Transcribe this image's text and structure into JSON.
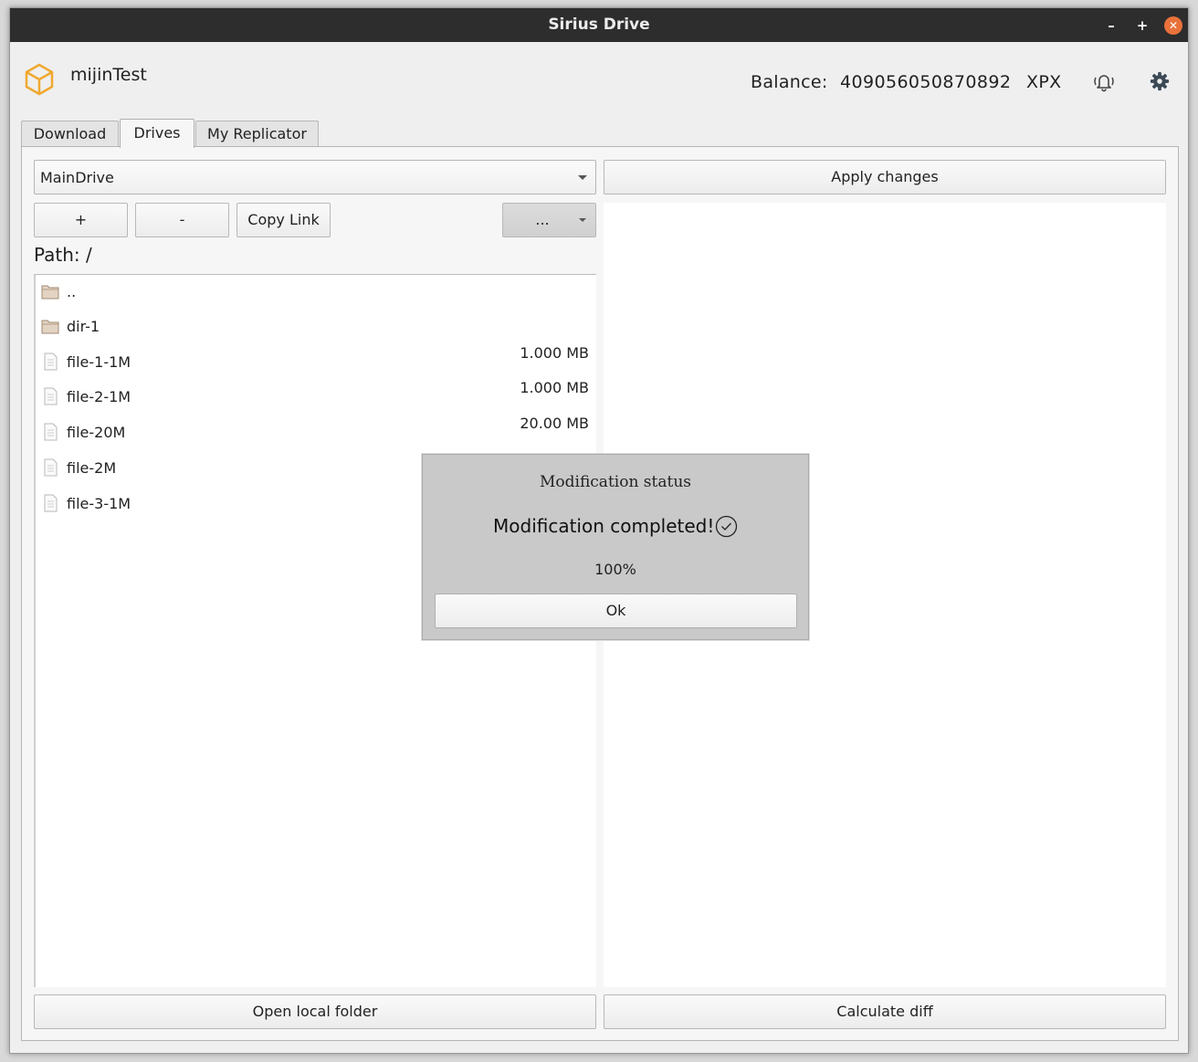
{
  "window": {
    "title": "Sirius Drive",
    "minimize_glyph": "–",
    "maximize_glyph": "+",
    "close_glyph": "✕"
  },
  "header": {
    "account_name": "mijinTest",
    "balance_label": "Balance:",
    "balance_value": "409056050870892",
    "currency": "XPX",
    "logo_icon": "cube-icon",
    "notification_icon": "bell-icon",
    "settings_icon": "gear-icon",
    "accent_color": "#f0a830"
  },
  "tabs": [
    {
      "label": "Download",
      "active": false
    },
    {
      "label": "Drives",
      "active": true
    },
    {
      "label": "My Replicator",
      "active": false
    }
  ],
  "drives": {
    "selected_drive": "MainDrive",
    "apply_label": "Apply changes",
    "add_label": "+",
    "remove_label": "-",
    "copy_link_label": "Copy Link",
    "more_label": "...",
    "path_label": "Path: /",
    "files": [
      {
        "name": "..",
        "type": "folder",
        "size": ""
      },
      {
        "name": "dir-1",
        "type": "folder",
        "size": ""
      },
      {
        "name": "file-1-1M",
        "type": "file",
        "size": "1.000 MB"
      },
      {
        "name": "file-2-1M",
        "type": "file",
        "size": "1.000 MB"
      },
      {
        "name": "file-20M",
        "type": "file",
        "size": "20.00 MB"
      },
      {
        "name": "file-2M",
        "type": "file",
        "size": ""
      },
      {
        "name": "file-3-1M",
        "type": "file",
        "size": ""
      }
    ],
    "open_folder_label": "Open local folder",
    "calculate_diff_label": "Calculate diff"
  },
  "dialog": {
    "title": "Modification status",
    "message": "Modification completed!",
    "progress": "100%",
    "ok_label": "Ok",
    "status_icon": "check-circle-icon"
  }
}
